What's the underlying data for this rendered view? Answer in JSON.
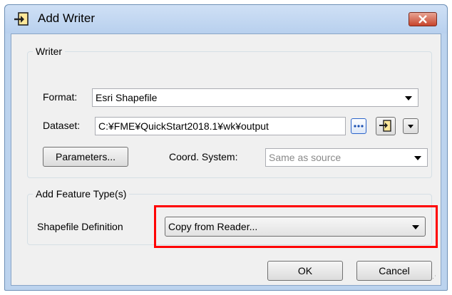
{
  "window": {
    "title": "Add Writer",
    "title_icon": "add-writer-icon",
    "close_icon": "close-icon"
  },
  "writer_group": {
    "label": "Writer",
    "format_label": "Format:",
    "format_value": "Esri Shapefile",
    "dataset_label": "Dataset:",
    "dataset_value": "C:¥FME¥QuickStart2018.1¥wk¥output",
    "parameters_button": "Parameters...",
    "coord_label": "Coord. System:",
    "coord_value": "Same as source"
  },
  "feature_group": {
    "label": "Add Feature Type(s)",
    "definition_label": "Shapefile Definition",
    "definition_value": "Copy from Reader..."
  },
  "buttons": {
    "ok": "OK",
    "cancel": "Cancel"
  },
  "colors": {
    "highlight": "#ff0000",
    "titlebar": "#b8d0ee",
    "close": "#c7442c"
  }
}
